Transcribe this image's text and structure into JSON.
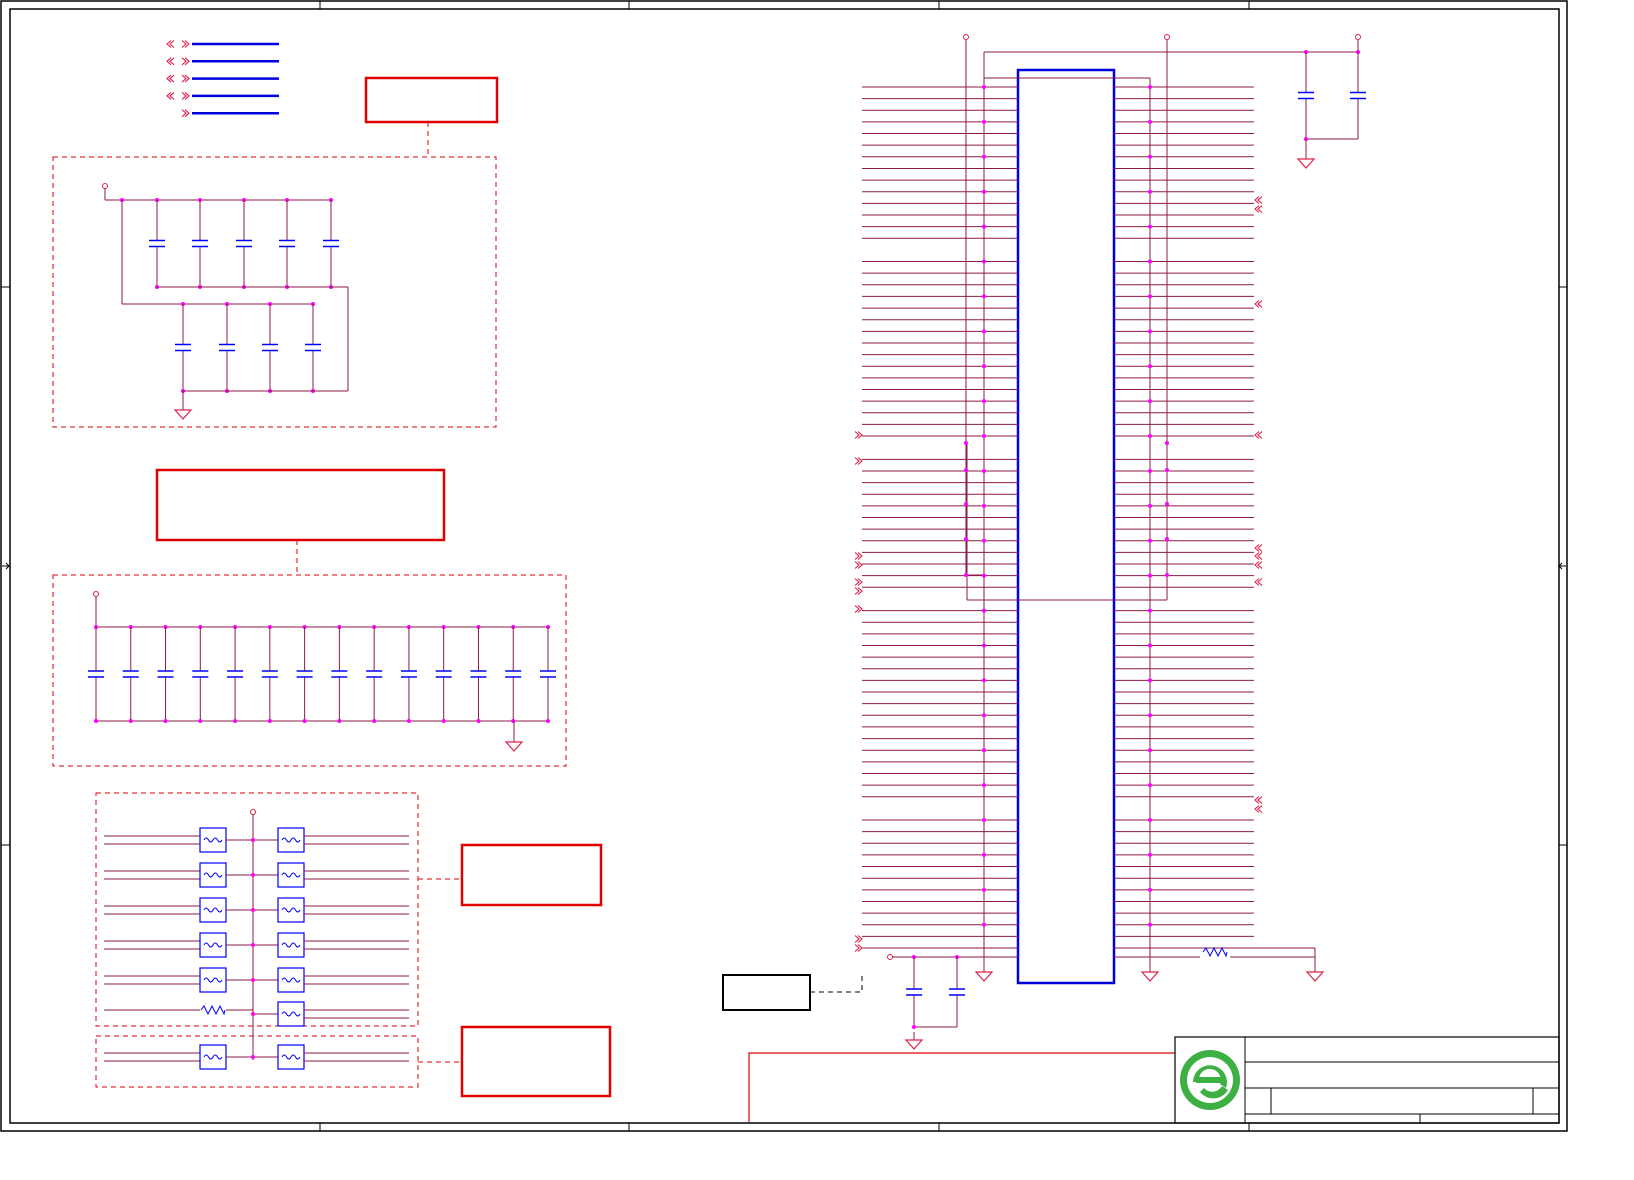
{
  "colors": {
    "background": "#ffffff",
    "frame": "#000000",
    "wire": "#8b1a4a",
    "net_connector": "#e0204a",
    "box_red": "#e00000",
    "bus_blue": "#0000dd",
    "component_blue": "#0000ff",
    "junction": "#ff00ff",
    "note_black": "#000000",
    "logo_green": "#3cb043"
  },
  "icons": {
    "logo": "company-logo-icon",
    "ground": "ground-icon",
    "capacitor": "capacitor-icon",
    "ferrite_bead": "ferrite-bead-icon",
    "resistor": "resistor-icon",
    "net_connector": "off-page-connector-icon",
    "power_flag": "power-port-icon"
  },
  "diagram": {
    "bus_legend": {
      "rows": 5,
      "double_connector_rows": 4
    },
    "decoupling_group_1": {
      "top_row_capacitors": 5,
      "bottom_row_capacitors": 4
    },
    "decoupling_group_2": {
      "capacitors": 14
    },
    "filter_group": {
      "bead_pairs": 5,
      "single_resistor_rows": 1,
      "extra_beads": 1
    },
    "filter_group_2": {
      "bead_pairs": 1
    },
    "connector": {
      "signal_lines_per_side": 75
    }
  }
}
